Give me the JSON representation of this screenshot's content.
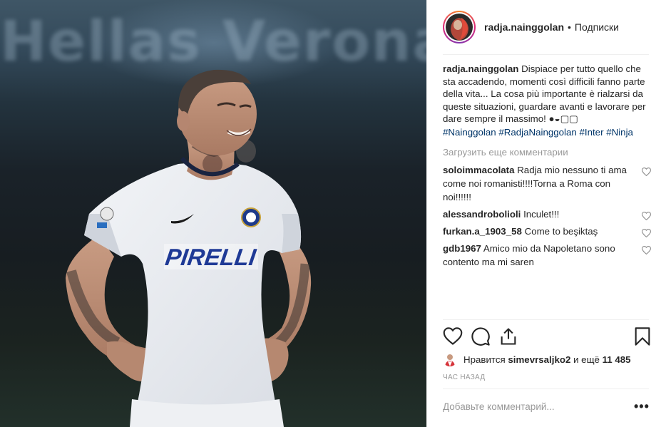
{
  "photo": {
    "stadium_text": "Hellas Verona",
    "jersey_sponsor": "PIRELLI"
  },
  "header": {
    "username": "radja.nainggolan",
    "separator": "•",
    "follow_label": "Подписки"
  },
  "caption": {
    "username": "radja.nainggolan",
    "text": "Dispiace per tutto quello che sta accadendo, momenti così difficili fanno parte della vita... La cosa più importante è rialzarsi da queste situazioni, guardare avanti e lavorare per dare sempre il massimo! ●◒▢▢",
    "hashtags": [
      "#Nainggolan",
      "#RadjaNainggolan",
      "#Inter",
      "#Ninja"
    ]
  },
  "load_more_label": "Загрузить еще комментарии",
  "comments": [
    {
      "username": "soloimmacolata",
      "text": "Radja mio nessuno ti ama come noi romanisti!!!!Torna a Roma con noi!!!!!!"
    },
    {
      "username": "alessandrobolioli",
      "text": "Inculet!!!"
    },
    {
      "username": "furkan.a_1903_58",
      "text": "Come to beşiktaş"
    },
    {
      "username": "gdb1967",
      "text": "Amico mio da Napoletano sono contento ma mi saren"
    }
  ],
  "likes": {
    "prefix": "Нравится",
    "user": "simevrsaljko2",
    "middle": "и ещё",
    "count": "11 485"
  },
  "timestamp": "ЧАС НАЗАД",
  "add_comment_placeholder": "Добавьте комментарий...",
  "more_options": "•••",
  "icons": [
    "heart-icon",
    "comment-icon",
    "share-icon",
    "bookmark-icon",
    "more-options-icon"
  ],
  "colors": {
    "hashtag": "#003569",
    "muted": "#999999",
    "text": "#262626",
    "divider": "#efefef"
  }
}
